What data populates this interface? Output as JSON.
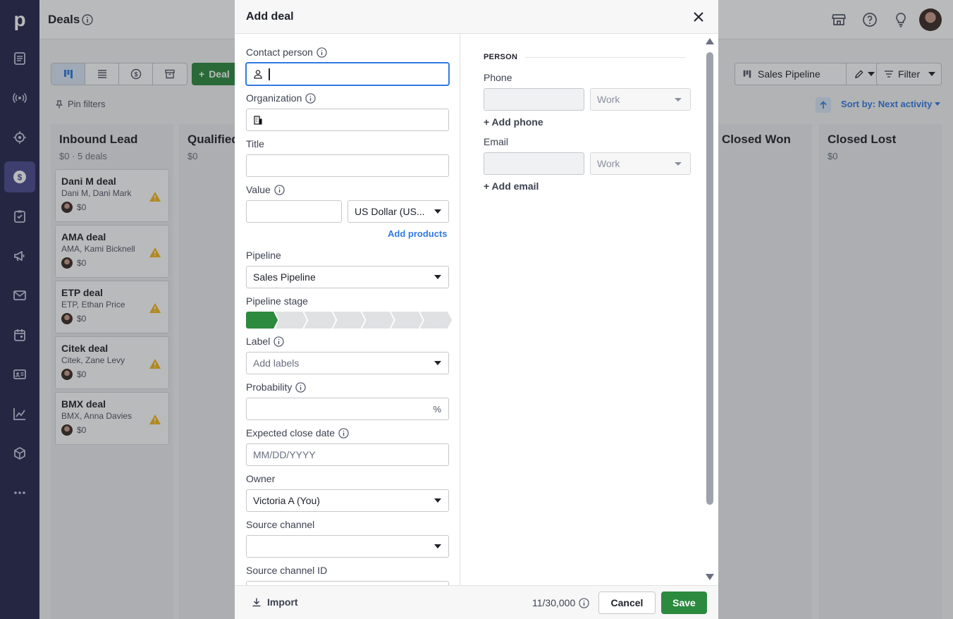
{
  "app": {
    "logo": "p",
    "page_title": "Deals"
  },
  "nav": {
    "items": [
      {
        "icon": "leads-icon"
      },
      {
        "icon": "broadcast-icon"
      },
      {
        "icon": "target-icon"
      },
      {
        "icon": "deals-icon",
        "active": true
      },
      {
        "icon": "tasks-icon"
      },
      {
        "icon": "campaigns-icon"
      },
      {
        "icon": "mail-icon"
      },
      {
        "icon": "calendar-icon"
      },
      {
        "icon": "contacts-icon"
      },
      {
        "icon": "insights-icon"
      },
      {
        "icon": "products-icon"
      },
      {
        "icon": "more-icon"
      }
    ]
  },
  "toolbar": {
    "deal_button": "Deal",
    "pin_filters": "Pin filters",
    "pipeline": "Sales Pipeline",
    "filter": "Filter",
    "sort_by": "Sort by: Next activity"
  },
  "board": {
    "columns": [
      {
        "title": "Inbound Lead",
        "sub": "$0 · 5 deals"
      },
      {
        "title": "Qualified",
        "sub": "$0"
      },
      {
        "title": "Closed Won",
        "sub": ""
      },
      {
        "title": "Closed Lost",
        "sub": "$0"
      }
    ],
    "cards": [
      {
        "title": "Dani M deal",
        "sub": "Dani M, Dani Mark",
        "value": "$0"
      },
      {
        "title": "AMA deal",
        "sub": "AMA, Kami Bicknell",
        "value": "$0"
      },
      {
        "title": "ETP deal",
        "sub": "ETP, Ethan Price",
        "value": "$0"
      },
      {
        "title": "Citek deal",
        "sub": "Citek, Zane Levy",
        "value": "$0"
      },
      {
        "title": "BMX deal",
        "sub": "BMX, Anna Davies",
        "value": "$0"
      }
    ]
  },
  "modal": {
    "title": "Add deal",
    "fields": {
      "contact_person": {
        "label": "Contact person",
        "value": ""
      },
      "organization": {
        "label": "Organization",
        "value": ""
      },
      "title": {
        "label": "Title",
        "value": ""
      },
      "value": {
        "label": "Value",
        "value": "",
        "currency": "US Dollar (US..."
      },
      "add_products": "Add products",
      "pipeline": {
        "label": "Pipeline",
        "value": "Sales Pipeline"
      },
      "pipeline_stage": {
        "label": "Pipeline stage",
        "stages": 7,
        "active_stage": 1
      },
      "label": {
        "label": "Label",
        "placeholder": "Add labels"
      },
      "probability": {
        "label": "Probability",
        "value": "",
        "unit": "%"
      },
      "expected_close_date": {
        "label": "Expected close date",
        "placeholder": "MM/DD/YYYY"
      },
      "owner": {
        "label": "Owner",
        "value": "Victoria A (You)"
      },
      "source_channel": {
        "label": "Source channel",
        "value": ""
      },
      "source_channel_id": {
        "label": "Source channel ID"
      }
    },
    "person": {
      "section": "PERSON",
      "phone_label": "Phone",
      "phone_type": "Work",
      "add_phone": "+ Add phone",
      "email_label": "Email",
      "email_type": "Work",
      "add_email": "+ Add email"
    },
    "footer": {
      "import": "Import",
      "char_count": "11/30,000",
      "cancel": "Cancel",
      "save": "Save"
    }
  },
  "colors": {
    "nav_bg": "#25254d",
    "accent_green": "#2c8a3f",
    "link_blue": "#317ae2"
  }
}
